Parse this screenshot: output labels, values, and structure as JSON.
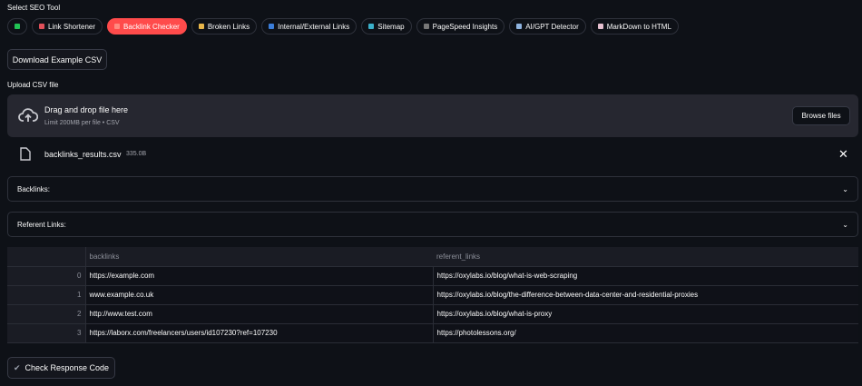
{
  "tool_label": "Select SEO Tool",
  "tools": [
    {
      "label": "",
      "color": "#21c354"
    },
    {
      "label": "Link Shortener",
      "color": "#e0505a"
    },
    {
      "label": "Backlink Checker",
      "color": "#ff8a80",
      "active": true
    },
    {
      "label": "Broken Links",
      "color": "#e8b64a"
    },
    {
      "label": "Internal/External Links",
      "color": "#3b7dd8"
    },
    {
      "label": "Sitemap",
      "color": "#3bb0c9"
    },
    {
      "label": "PageSpeed Insights",
      "color": "#777"
    },
    {
      "label": "AI/GPT Detector",
      "color": "#8fb4e0"
    },
    {
      "label": "MarkDown to HTML",
      "color": "#e6c0d0"
    }
  ],
  "download_label": "Download Example CSV",
  "upload_label": "Upload CSV file",
  "dropzone": {
    "title": "Drag and drop file here",
    "subtitle": "Limit 200MB per file • CSV",
    "browse": "Browse files"
  },
  "file": {
    "name": "backlinks_results.csv",
    "size": "335.0B"
  },
  "expanders": [
    "Backlinks:",
    "Referent Links:"
  ],
  "table": {
    "columns": [
      "backlinks",
      "referent_links"
    ],
    "rows": [
      {
        "idx": "0",
        "backlinks": "https://example.com",
        "referent_links": "https://oxylabs.io/blog/what-is-web-scraping"
      },
      {
        "idx": "1",
        "backlinks": "www.example.co.uk",
        "referent_links": "https://oxylabs.io/blog/the-difference-between-data-center-and-residential-proxies"
      },
      {
        "idx": "2",
        "backlinks": "http://www.test.com",
        "referent_links": "https://oxylabs.io/blog/what-is-proxy"
      },
      {
        "idx": "3",
        "backlinks": "https://laborx.com/freelancers/users/id107230?ref=107230",
        "referent_links": "https://photolessons.org/"
      }
    ]
  },
  "check_label": "Check Response Code"
}
